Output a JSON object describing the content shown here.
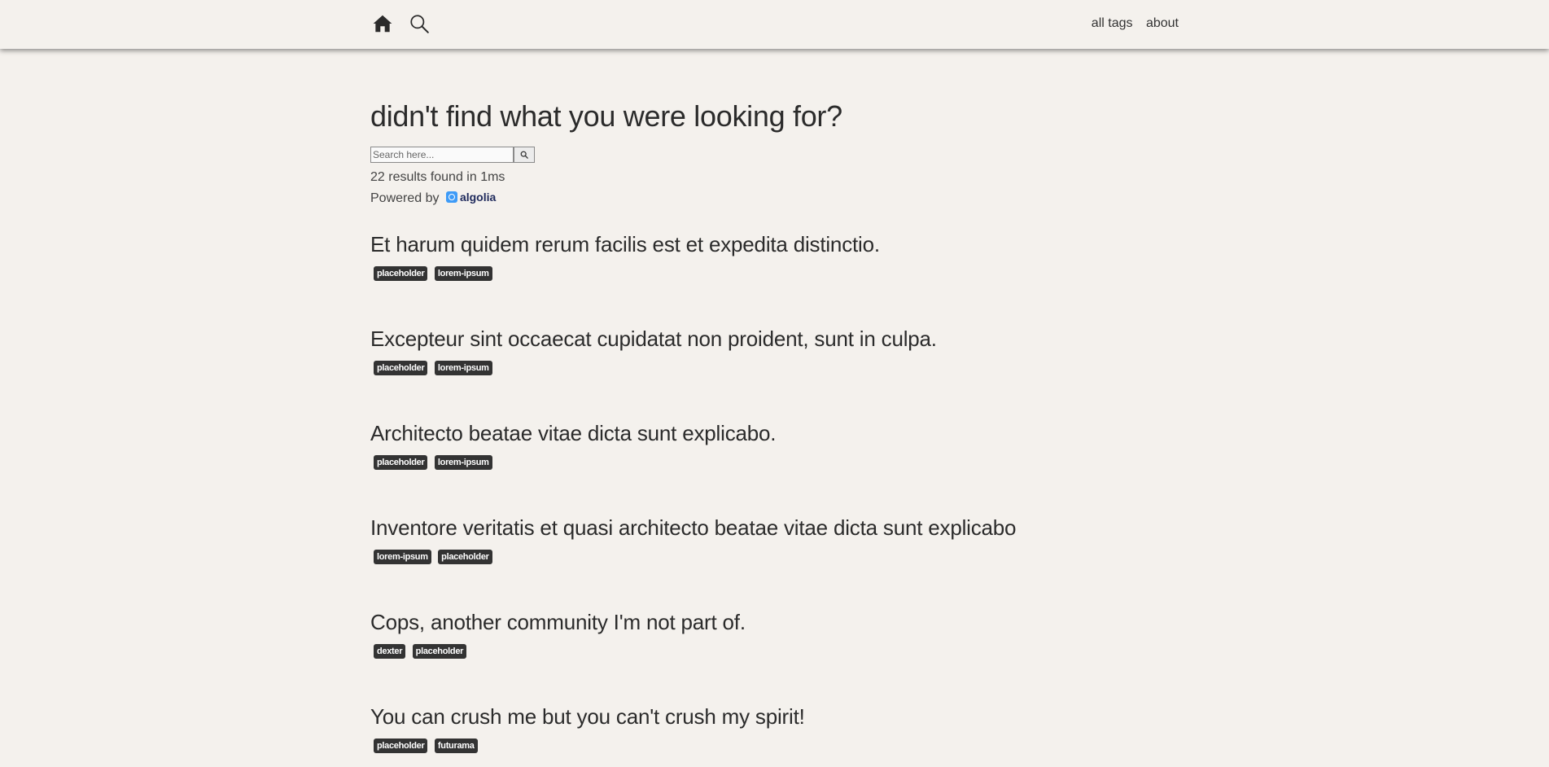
{
  "nav": {
    "home_icon": "home-icon",
    "search_icon": "search-icon",
    "links": [
      {
        "label": "all tags"
      },
      {
        "label": "about"
      }
    ]
  },
  "page": {
    "title": "didn't find what you were looking for?"
  },
  "search": {
    "placeholder": "Search here...",
    "value": "",
    "submit_icon": "search-icon"
  },
  "stats": {
    "text": "22 results found in 1ms"
  },
  "powered": {
    "label": "Powered by",
    "brand": "algolia"
  },
  "results": [
    {
      "title": "Et harum quidem rerum facilis est et expedita distinctio.",
      "tags": [
        "placeholder",
        "lorem-ipsum"
      ]
    },
    {
      "title": "Excepteur sint occaecat cupidatat non proident, sunt in culpa.",
      "tags": [
        "placeholder",
        "lorem-ipsum"
      ]
    },
    {
      "title": "Architecto beatae vitae dicta sunt explicabo.",
      "tags": [
        "placeholder",
        "lorem-ipsum"
      ]
    },
    {
      "title": "Inventore veritatis et quasi architecto beatae vitae dicta sunt explicabo",
      "tags": [
        "lorem-ipsum",
        "placeholder"
      ]
    },
    {
      "title": "Cops, another community I'm not part of.",
      "tags": [
        "dexter",
        "placeholder"
      ]
    },
    {
      "title": "You can crush me but you can't crush my spirit!",
      "tags": [
        "placeholder",
        "futurama"
      ]
    }
  ],
  "colors": {
    "background": "#f4f1ed",
    "text": "#2b2b2b",
    "tag_bg": "#333333",
    "tag_text": "#ffffff",
    "algolia_blue": "#3e9bf7"
  }
}
